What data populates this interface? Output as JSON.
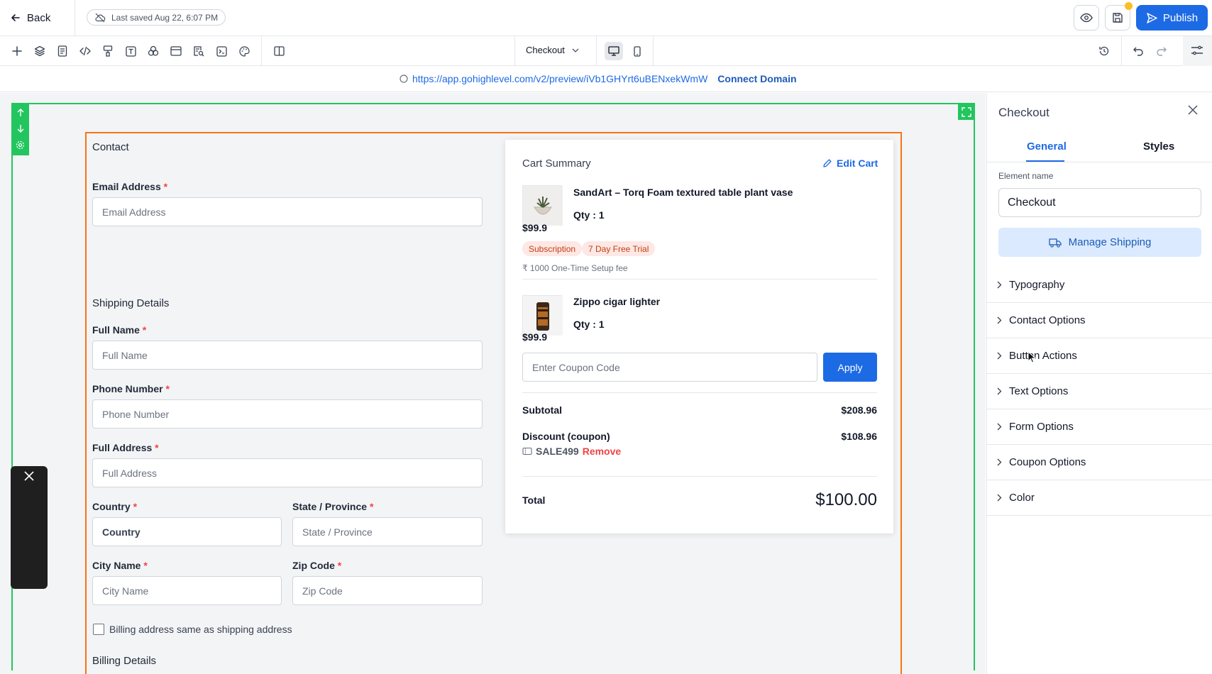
{
  "topbar": {
    "back_label": "Back",
    "saved_text": "Last saved Aug 22, 6:07 PM",
    "publish_label": "Publish"
  },
  "toolbar": {
    "page_select": "Checkout",
    "tools": [
      "add-icon",
      "layers-icon",
      "pages-icon",
      "code-icon",
      "paint-icon",
      "text-icon",
      "shapes-icon",
      "layout-icon",
      "search-doc-icon",
      "terminal-icon",
      "palette-icon",
      "columns-icon"
    ]
  },
  "urlbar": {
    "url": "https://app.gohighlevel.com/v2/preview/iVb1GHYrt6uBENxekWmW",
    "connect_domain": "Connect Domain"
  },
  "form": {
    "contact_title": "Contact",
    "email_label": "Email Address",
    "email_placeholder": "Email Address",
    "shipping_title": "Shipping Details",
    "fullname_label": "Full Name",
    "fullname_placeholder": "Full Name",
    "phone_label": "Phone Number",
    "phone_placeholder": "Phone Number",
    "address_label": "Full Address",
    "address_placeholder": "Full Address",
    "country_label": "Country",
    "country_placeholder": "Country",
    "state_label": "State / Province",
    "state_placeholder": "State / Province",
    "city_label": "City Name",
    "city_placeholder": "City Name",
    "zip_label": "Zip Code",
    "zip_placeholder": "Zip Code",
    "billing_same_label": "Billing address same as shipping address",
    "billing_title": "Billing Details",
    "required_mark": "*"
  },
  "cart": {
    "title": "Cart Summary",
    "edit_cart": "Edit Cart",
    "items": [
      {
        "name": "SandArt – Torq Foam textured table plant vase",
        "qty": "Qty : 1",
        "price": "$99.9",
        "badges": [
          "Subscription",
          "7 Day Free Trial"
        ],
        "setup_fee": "₹ 1000 One-Time Setup fee"
      },
      {
        "name": "Zippo cigar lighter",
        "qty": "Qty : 1",
        "price": "$99.9"
      }
    ],
    "coupon_placeholder": "Enter Coupon Code",
    "apply_label": "Apply",
    "subtotal_label": "Subtotal",
    "subtotal_value": "$208.96",
    "discount_label": "Discount (coupon)",
    "discount_value": "$108.96",
    "coupon_code": "SALE499",
    "remove_label": "Remove",
    "total_label": "Total",
    "total_value": "$100.00"
  },
  "panel": {
    "title": "Checkout",
    "tabs": [
      "General",
      "Styles"
    ],
    "element_name_label": "Element name",
    "element_name_value": "Checkout",
    "manage_shipping": "Manage Shipping",
    "sections": [
      "Typography",
      "Contact Options",
      "Button Actions",
      "Text Options",
      "Form Options",
      "Coupon Options",
      "Color"
    ]
  },
  "colors": {
    "accent": "#1d6ae5",
    "section_outline": "#22c55e",
    "element_outline": "#f97316",
    "required": "#ef4444",
    "badge_bg": "#fde8e6",
    "badge_text": "#c2410c"
  }
}
